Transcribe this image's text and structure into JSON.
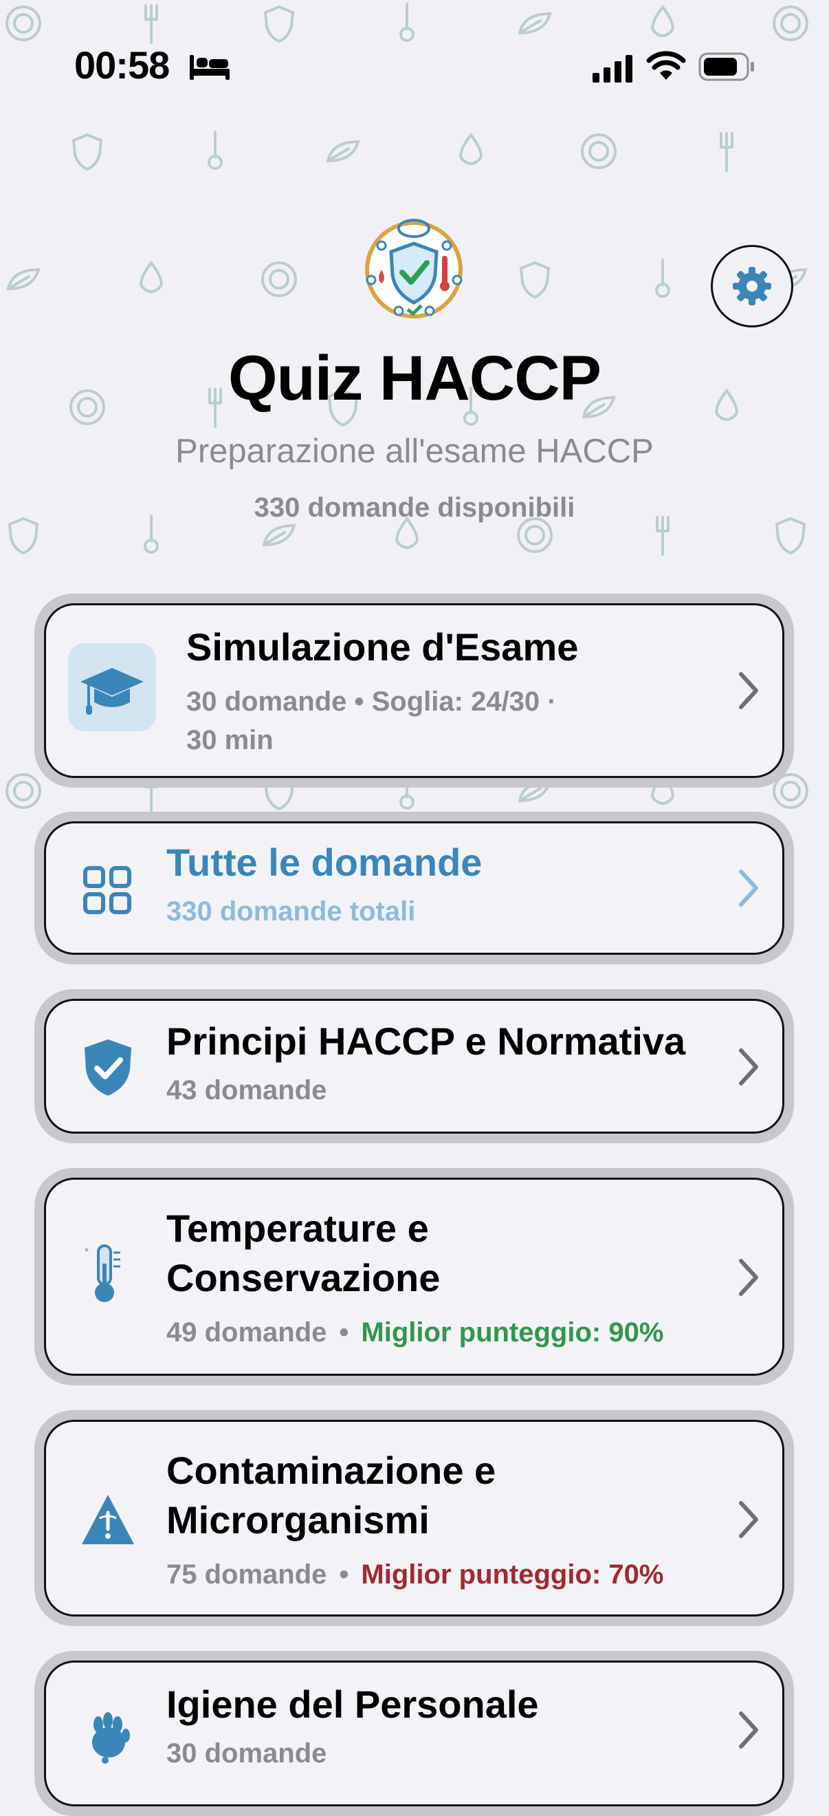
{
  "status_bar": {
    "time": "00:58",
    "icons": [
      "bed-icon",
      "cellular-signal-icon",
      "wifi-icon",
      "battery-icon"
    ]
  },
  "header": {
    "logo": "haccp-shield-logo",
    "title": "Quiz HACCP",
    "subtitle": "Preparazione all'esame HACCP",
    "question_count": "330 domande disponibili",
    "settings_icon": "gear-icon"
  },
  "colors": {
    "accent": "#3a86b8",
    "background": "#f1f1f5",
    "pattern": "#b9cfc8",
    "success": "#34954d",
    "danger": "#a12a2e"
  },
  "exam_card": {
    "title": "Simulazione d'Esame",
    "details_line1": "30 domande • Soglia: 24/30 ·",
    "details_line2": "30 min",
    "icon": "graduation-cap-icon"
  },
  "all_questions_card": {
    "title": "Tutte le domande",
    "subtitle": "330 domande totali",
    "icon": "grid-icon"
  },
  "categories": [
    {
      "title": "Principi HACCP e Normativa",
      "count": "43 domande",
      "icon": "shield-check-icon"
    },
    {
      "title_line1": "Temperature e",
      "title_line2": "Conservazione",
      "count": "49 domande",
      "separator": "•",
      "best_score": "Miglior punteggio: 90%",
      "icon": "thermometer-icon"
    },
    {
      "title_line1": "Contaminazione e",
      "title_line2": "Microrganismi",
      "count": "75 domande",
      "separator": "•",
      "best_score": "Miglior punteggio: 70%",
      "icon": "warning-triangle-icon"
    },
    {
      "title": "Igiene del Personale",
      "count": "30 domande",
      "icon": "hand-icon"
    }
  ]
}
